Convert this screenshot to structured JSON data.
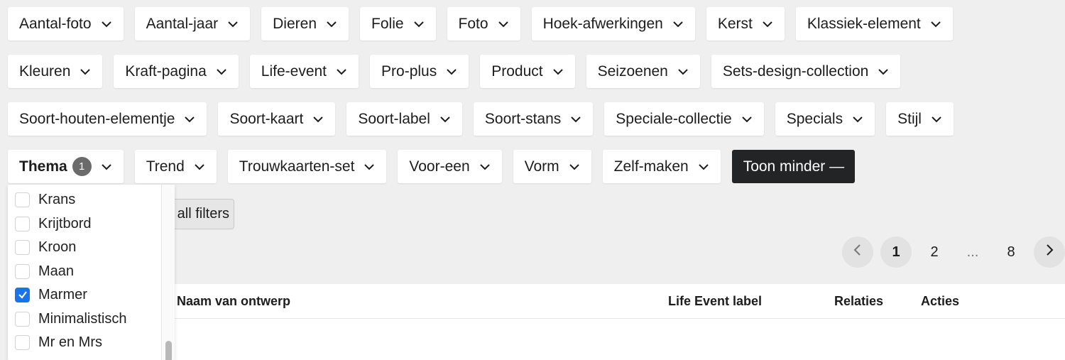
{
  "filters": {
    "row1": [
      "Aantal-foto",
      "Aantal-jaar",
      "Dieren",
      "Folie",
      "Foto",
      "Hoek-afwerkingen",
      "Kerst",
      "Klassiek-element"
    ],
    "row2": [
      "Kleuren",
      "Kraft-pagina",
      "Life-event",
      "Pro-plus",
      "Product",
      "Seizoenen",
      "Sets-design-collection"
    ],
    "row3": [
      "Soort-houten-elementje",
      "Soort-kaart",
      "Soort-label",
      "Soort-stans",
      "Speciale-collectie",
      "Specials",
      "Stijl"
    ],
    "row4": {
      "thema": {
        "label": "Thema",
        "count": "1"
      },
      "rest": [
        "Trend",
        "Trouwkaarten-set",
        "Voor-een",
        "Vorm",
        "Zelf-maken"
      ],
      "toggle": "Toon minder —"
    }
  },
  "clear_button": "all filters",
  "dropdown": {
    "options": [
      {
        "label": "Krans",
        "checked": false
      },
      {
        "label": "Krijtbord",
        "checked": false
      },
      {
        "label": "Kroon",
        "checked": false
      },
      {
        "label": "Maan",
        "checked": false
      },
      {
        "label": "Marmer",
        "checked": true
      },
      {
        "label": "Minimalistisch",
        "checked": false
      },
      {
        "label": "Mr en Mrs",
        "checked": false
      }
    ]
  },
  "pagination": {
    "pages": [
      "1",
      "2",
      "...",
      "8"
    ],
    "current": "1"
  },
  "table": {
    "columns": [
      "Naam van ontwerp",
      "Life Event label",
      "Relaties",
      "Acties"
    ]
  },
  "colors": {
    "accent": "#1a73e8",
    "dark_button": "#222426",
    "badge": "#6b6b6b"
  },
  "icons": {
    "chevron": "chevron-down-icon",
    "prev": "chevron-left-icon",
    "next": "chevron-right-icon",
    "check": "check-icon"
  }
}
